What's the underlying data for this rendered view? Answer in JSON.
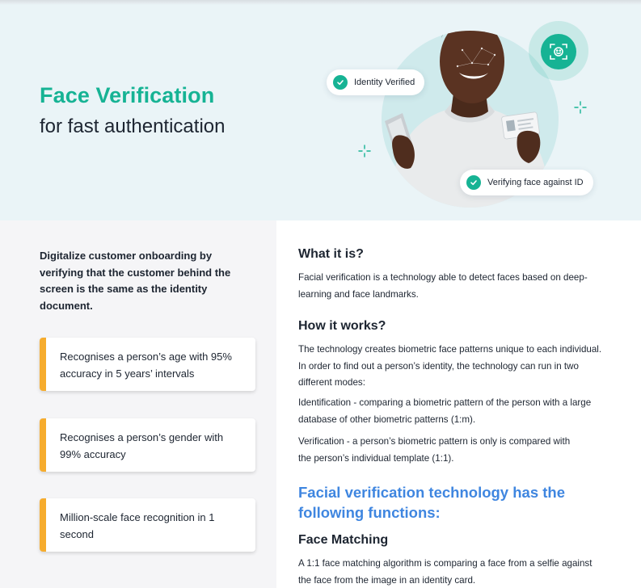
{
  "hero": {
    "title": "Face Verification",
    "subtitle": "for fast authentication",
    "badge_identity": "Identity Verified",
    "badge_verifying": "Verifying face against ID",
    "accent_color": "#16b394",
    "scan_icon": "face-scan-icon"
  },
  "left": {
    "intro": "Digitalize customer onboarding by verifying that the customer behind the screen is the same as the identity document.",
    "cards": [
      {
        "text": "Recognises a person’s age with 95% accuracy in 5 years’ intervals"
      },
      {
        "text": "Recognises a person’s gender with 99% accuracy"
      },
      {
        "text": "Million-scale face recognition in 1 second"
      }
    ],
    "card_accent_color": "#f6ac2e"
  },
  "right": {
    "what_heading": "What it is?",
    "what_text": "Facial verification is a technology able to detect faces based on deep-learning and face landmarks.",
    "how_heading": "How it works?",
    "how_text": "The technology creates biometric face patterns unique to each individual. In order to find out a person’s identity, the technology can run in two different modes:",
    "identification_text": "Identification - comparing a biometric pattern of the person with a large database of other biometric patterns (1:m).",
    "verification_text": "Verification - a person’s biometric pattern is only is compared with the person’s individual template (1:1).",
    "functions_heading": "Facial verification technology has the following functions:",
    "functions_color": "#3f86e0",
    "face_matching_heading": "Face Matching",
    "face_matching_text": "A 1:1 face matching algorithm is comparing a face from a selfie against the face from the image in an identity card."
  }
}
